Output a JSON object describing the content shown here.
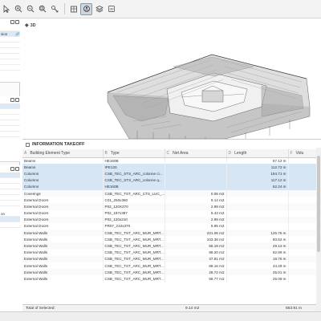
{
  "toolbar": {
    "buttons": [
      {
        "icon": "cursor-icon"
      },
      {
        "icon": "zoom-in-icon"
      },
      {
        "icon": "zoom-out-icon"
      },
      {
        "icon": "zoom-fit-icon"
      },
      {
        "icon": "measure-tool-icon"
      },
      {
        "icon": "building-view-icon"
      },
      {
        "icon": "orbit-3d-icon",
        "active": true
      },
      {
        "icon": "layers-icon"
      },
      {
        "icon": "3d-mode-icon"
      }
    ]
  },
  "sidebar": {
    "panel1": {
      "line1": "sion"
    },
    "panel3": {
      "line1": "on"
    }
  },
  "view": {
    "label": "3D"
  },
  "takeoff": {
    "title": "INFORMATION TAKEOFF",
    "columns": [
      {
        "letter": "A",
        "label": "Building Element Type"
      },
      {
        "letter": "B",
        "label": "Type"
      },
      {
        "letter": "C",
        "label": "Net Area"
      },
      {
        "letter": "D",
        "label": "Length"
      },
      {
        "letter": "F",
        "label": "Volu"
      }
    ],
    "rows": [
      [
        "Beams",
        "HE160B",
        "",
        "67.12 m",
        "",
        false
      ],
      [
        "Beams",
        "IPE120",
        "",
        "112.72 m",
        "",
        true
      ],
      [
        "Columns",
        "CSB_TEC_STS_ARC_colonne ci...",
        "",
        "194.71 m",
        "",
        true
      ],
      [
        "Columns",
        "CSB_TEC_STS_ARC_colonne q...",
        "",
        "117.12 m",
        "",
        true
      ],
      [
        "Columns",
        "HE160B",
        "",
        "62.24 m",
        "",
        true
      ],
      [
        "Coverings",
        "CSB_TEC_TST_ARC_CTS_LUC_...",
        "0.06 m2",
        "",
        "",
        false
      ],
      [
        "External Doors",
        "C01_260x360",
        "9.14 m2",
        "",
        "",
        false
      ],
      [
        "External Doors",
        "P02_120X270",
        "2.99 m2",
        "",
        "",
        false
      ],
      [
        "External Doors",
        "P02_197x387",
        "6.43 m2",
        "",
        "",
        false
      ],
      [
        "External Doors",
        "P02_120x210",
        "2.99 m2",
        "",
        "",
        false
      ],
      [
        "External Doors",
        "PR07_210x370",
        "6.95 m2",
        "",
        "",
        false
      ],
      [
        "External Walls",
        "CSB_TEC_TST_ARC_MUR_MRT...",
        "221.06 m2",
        "125.75 m",
        "",
        false
      ],
      [
        "External Walls",
        "CSB_TEC_TST_ARC_MUR_MRT...",
        "103.38 m2",
        "60.52 m",
        "",
        false
      ],
      [
        "External Walls",
        "CSB_TEC_TST_ARC_MUR_MRT...",
        "56.19 m2",
        "29.13 m",
        "",
        false
      ],
      [
        "External Walls",
        "CSB_TEC_TST_ARC_MUR_MRT...",
        "99.20 m2",
        "62.89 m",
        "",
        false
      ],
      [
        "External Walls",
        "CSB_TEC_TST_ARC_MUR_MRT...",
        "37.81 m2",
        "18.75 m",
        "",
        false
      ],
      [
        "External Walls",
        "CSB_TEC_TST_ARC_MUR_MRT...",
        "68.16 m2",
        "44.29 m",
        "",
        false
      ],
      [
        "External Walls",
        "CSB_TEC_TST_ARC_MUR_MRT...",
        "28.72 m2",
        "25.01 m",
        "",
        false
      ],
      [
        "External Walls",
        "CSB_TEC_TST_ARC_MUR_MRT...",
        "59.77 m2",
        "26.09 m",
        "",
        false
      ]
    ],
    "footer": {
      "label": "Total of Selected:",
      "area": "9.14 m2",
      "length": "553.91 m"
    }
  }
}
